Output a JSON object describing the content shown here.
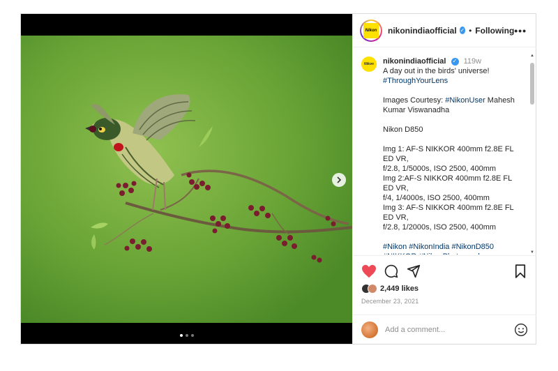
{
  "post": {
    "username": "nikonindiaofficial",
    "follow_separator": "•",
    "follow_status": "Following",
    "more_label": "•••",
    "logo_text": "Nikon",
    "caption": {
      "username": "nikonindiaofficial",
      "time": "119w",
      "lines": [
        {
          "text": "A day out in the birds' universe!",
          "type": "text"
        },
        {
          "text": "#ThroughYourLens",
          "type": "tag"
        },
        {
          "text": "",
          "type": "blank"
        },
        {
          "text": "Images Courtesy: ",
          "tag": "#NikonUser",
          "rest": " Mahesh Kumar Viswanadha",
          "type": "mixed"
        },
        {
          "text": "",
          "type": "blank"
        },
        {
          "text": "Nikon D850",
          "type": "text"
        },
        {
          "text": "",
          "type": "blank"
        },
        {
          "text": "Img 1: AF-S NIKKOR 400mm f2.8E FL ED VR,",
          "type": "text"
        },
        {
          "text": "f/2.8, 1/5000s, ISO 2500, 400mm",
          "type": "text"
        },
        {
          "text": "Img 2:AF-S NIKKOR 400mm f2.8E FL ED VR,",
          "type": "text"
        },
        {
          "text": "f/4, 1/4000s, ISO 2500, 400mm",
          "type": "text"
        },
        {
          "text": "Img 3: AF-S NIKKOR 400mm f2.8E FL ED VR,",
          "type": "text"
        },
        {
          "text": "f/2.8, 1/2000s, ISO 2500, 400mm",
          "type": "text"
        },
        {
          "text": "",
          "type": "blank"
        },
        {
          "text": "#Nikon #NikonIndia #NikonD850",
          "type": "tag"
        },
        {
          "text": "#NIKKOR #NikonPhotography",
          "type": "tag"
        }
      ]
    },
    "likes": "2,449 likes",
    "date": "December 23, 2021",
    "comment_placeholder": "Add a comment...",
    "carousel": {
      "total": 3,
      "active": 0
    },
    "colors": {
      "like_red": "#ed4956",
      "verified_blue": "#3897f0",
      "hashtag": "#00376b"
    },
    "icons": [
      "heart-icon",
      "comment-icon",
      "share-icon",
      "bookmark-icon",
      "emoji-icon",
      "chevron-right-icon",
      "verified-icon"
    ]
  }
}
